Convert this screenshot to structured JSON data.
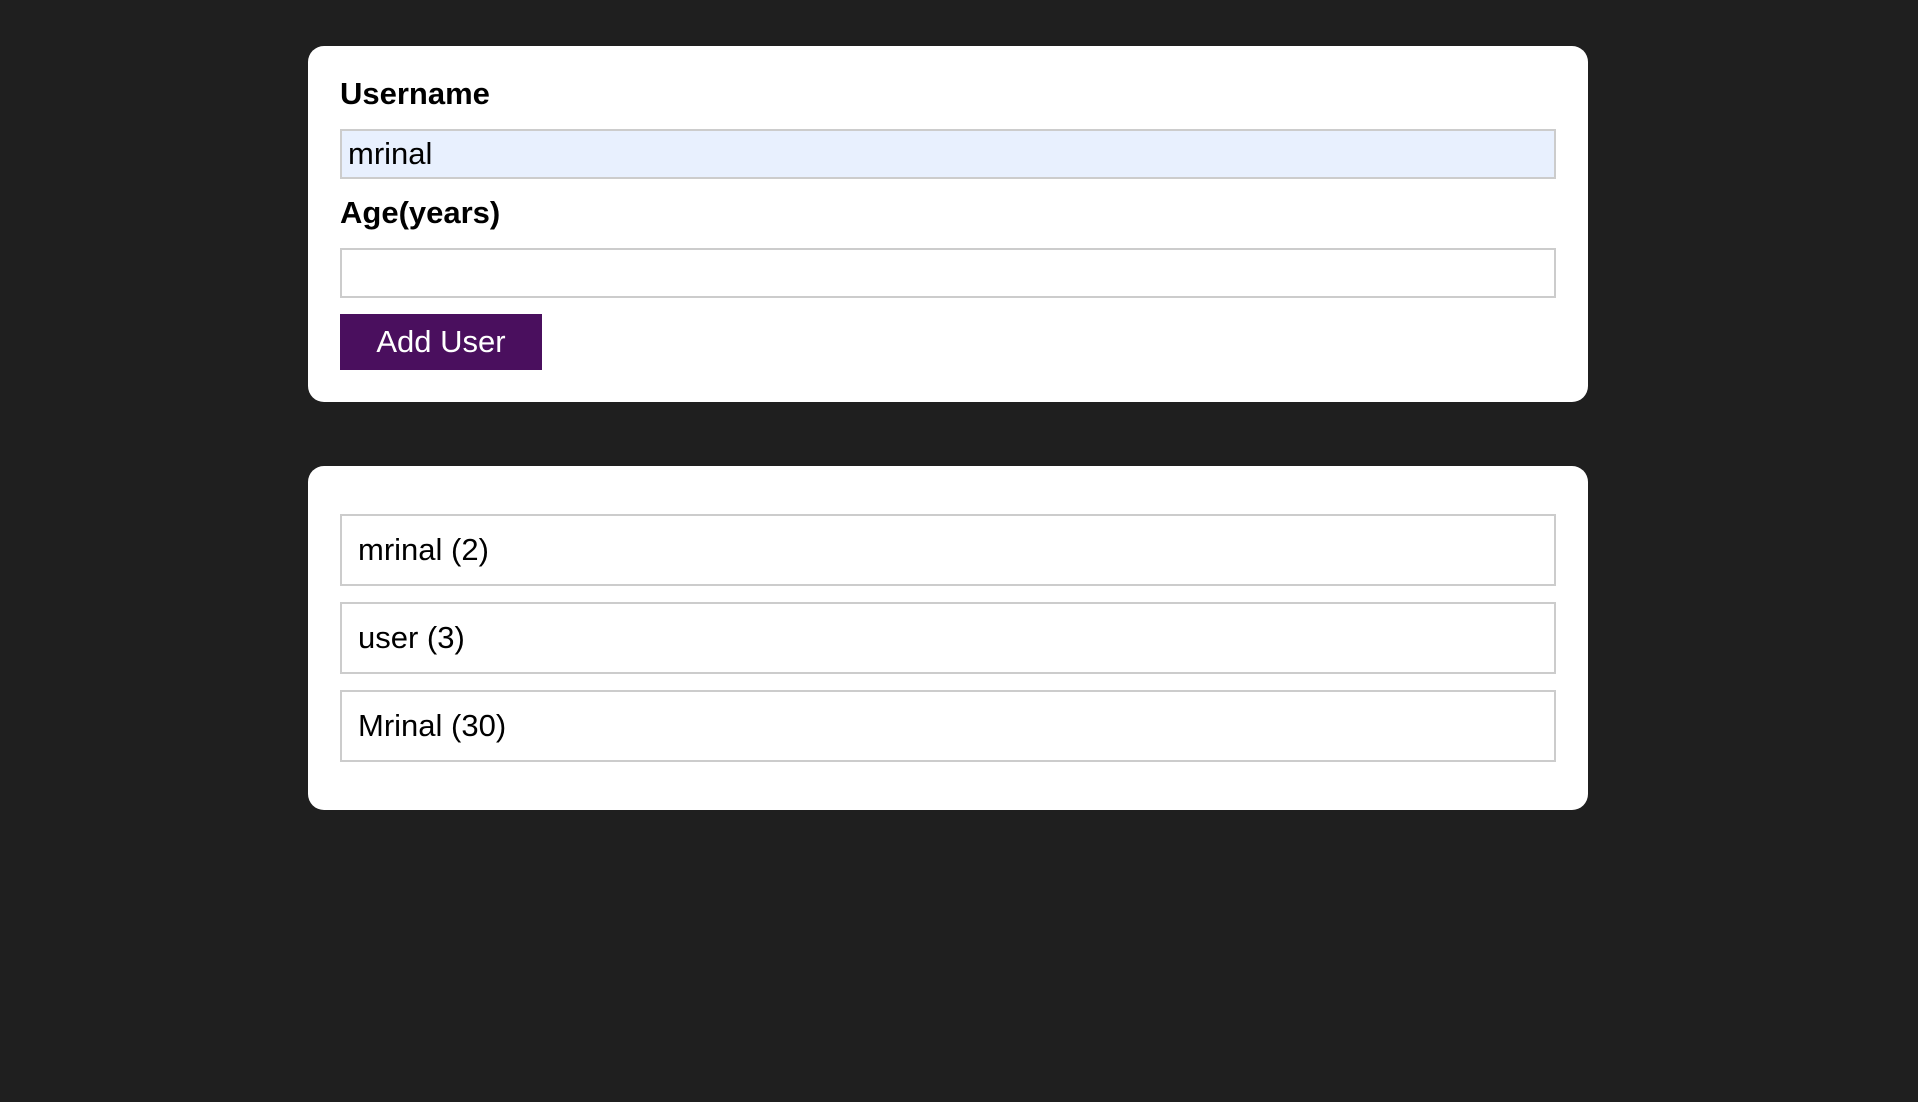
{
  "form": {
    "username_label": "Username",
    "username_value": "mrinal",
    "age_label": "Age(years)",
    "age_value": "",
    "add_button_label": "Add User",
    "button_color": "#4a0f5e"
  },
  "users": {
    "items": [
      {
        "text": "mrinal (2)"
      },
      {
        "text": "user (3)"
      },
      {
        "text": "Mrinal (30)"
      }
    ]
  }
}
